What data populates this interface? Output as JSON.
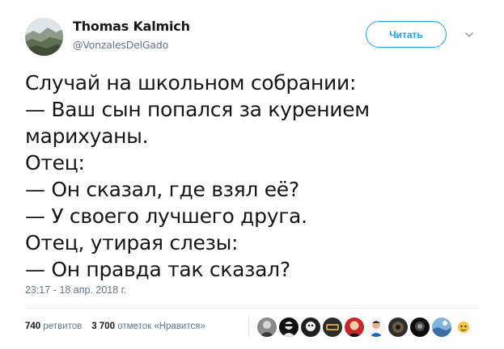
{
  "tweet": {
    "author": {
      "display_name": "Thomas Kalmich",
      "handle": "@VonzalesDelGado",
      "avatar": "landscape-avatar"
    },
    "follow_label": "Читать",
    "menu_icon": "chevron-down-icon",
    "text_lines": [
      "Случай на школьном собрании:",
      "— Ваш сын попался за курением",
      "марихуаны.",
      "Отец:",
      "— Он сказал, где взял её?",
      "— У своего лучшего друга.",
      "Отец, утирая слезы:",
      "— Он правда так сказал?"
    ],
    "timestamp": "23:17 - 18 апр. 2018 г."
  },
  "stats": {
    "retweets_count": "740",
    "retweets_label": "ретвитов",
    "likes_count": "3 700",
    "likes_label": "отметок «Нравится»"
  },
  "likers": [
    "liker-avatar-1",
    "liker-avatar-2",
    "liker-avatar-3",
    "liker-avatar-4",
    "liker-avatar-5",
    "liker-avatar-6",
    "liker-avatar-7",
    "liker-avatar-8",
    "liker-avatar-9",
    "liker-avatar-10"
  ],
  "colors": {
    "accent": "#1da1f2",
    "text": "#14171a",
    "secondary": "#657786",
    "divider": "#e6ecf0"
  }
}
